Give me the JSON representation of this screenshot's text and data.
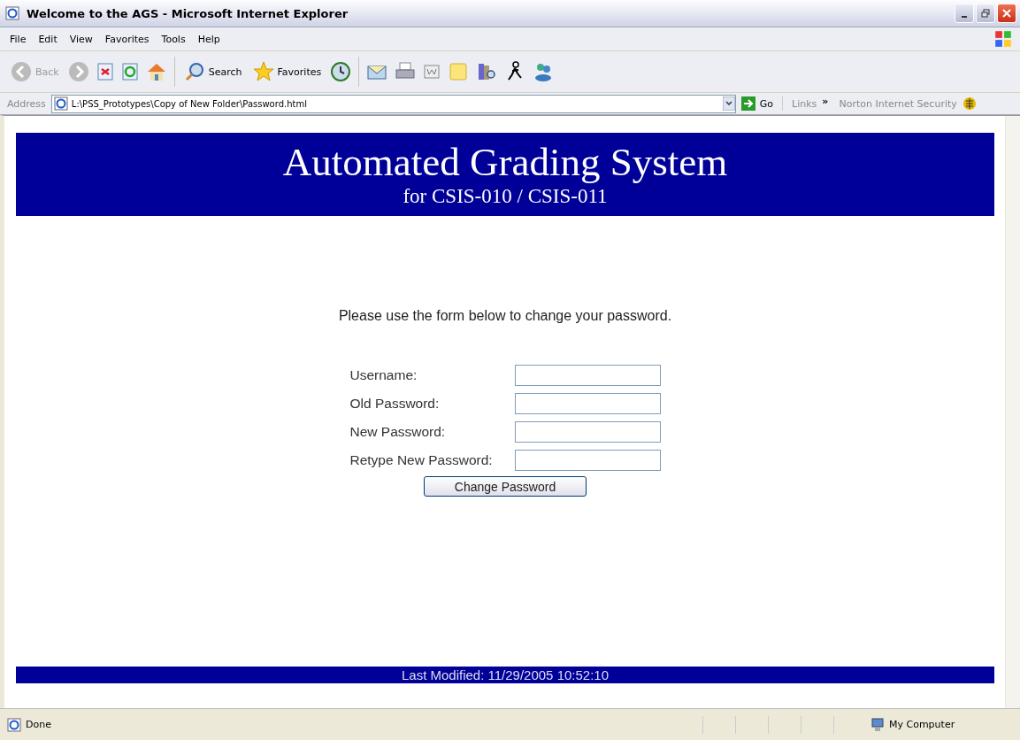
{
  "window": {
    "title": "Welcome to the AGS - Microsoft Internet Explorer"
  },
  "menu": [
    "File",
    "Edit",
    "View",
    "Favorites",
    "Tools",
    "Help"
  ],
  "toolbar": {
    "back": {
      "label": "Back",
      "disabled": true
    },
    "search": "Search",
    "favorites": "Favorites"
  },
  "address_bar": {
    "label": "Address",
    "value": "L:\\PSS_Prototypes\\Copy of New Folder\\Password.html",
    "go": "Go",
    "links": "Links",
    "chevron": "»",
    "norton": "Norton Internet Security"
  },
  "page": {
    "title": "Automated Grading System",
    "subtitle": "for CSIS-010 / CSIS-011",
    "instruction": "Please use the form below to change your password.",
    "fields": [
      {
        "label": "Username:"
      },
      {
        "label": "Old Password:"
      },
      {
        "label": "New Password:"
      },
      {
        "label": "Retype New Password:"
      }
    ],
    "button": "Change Password",
    "footer": "Last Modified: 11/29/2005 10:52:10"
  },
  "status_bar": {
    "text": "Done",
    "zone": "My Computer"
  }
}
